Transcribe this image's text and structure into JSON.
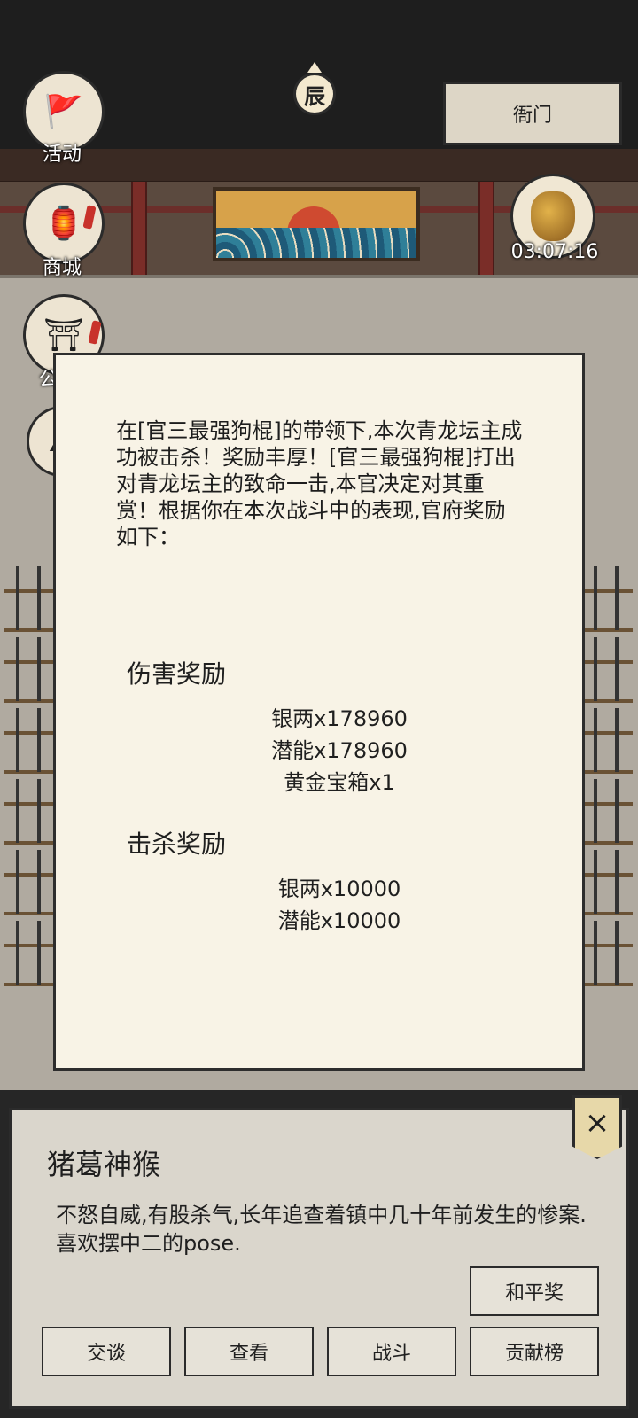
{
  "hud": {
    "activity_label": "活动",
    "shop_label": "商城",
    "third_label": "公",
    "time_char": "辰",
    "yamen_label": "衙门",
    "timer": "03:07:16"
  },
  "dialog": {
    "message": "在[官三最强狗棍]的带领下,本次青龙坛主成功被击杀！奖励丰厚！[官三最强狗棍]打出对青龙坛主的致命一击,本官决定对其重赏！根据你在本次战斗中的表现,官府奖励如下：",
    "damage_title": "伤害奖励",
    "damage_items": [
      "银两x178960",
      "潜能x178960",
      "黄金宝箱x1"
    ],
    "kill_title": "击杀奖励",
    "kill_items": [
      "银两x10000",
      "潜能x10000"
    ]
  },
  "npc": {
    "name": "猪葛神猴",
    "description": "不怒自威,有股杀气,长年追查着镇中几十年前发生的惨案.喜欢摆中二的pose.",
    "peace_button": "和平奖",
    "buttons": [
      "交谈",
      "查看",
      "战斗",
      "贡献榜"
    ],
    "close_icon": "×"
  }
}
